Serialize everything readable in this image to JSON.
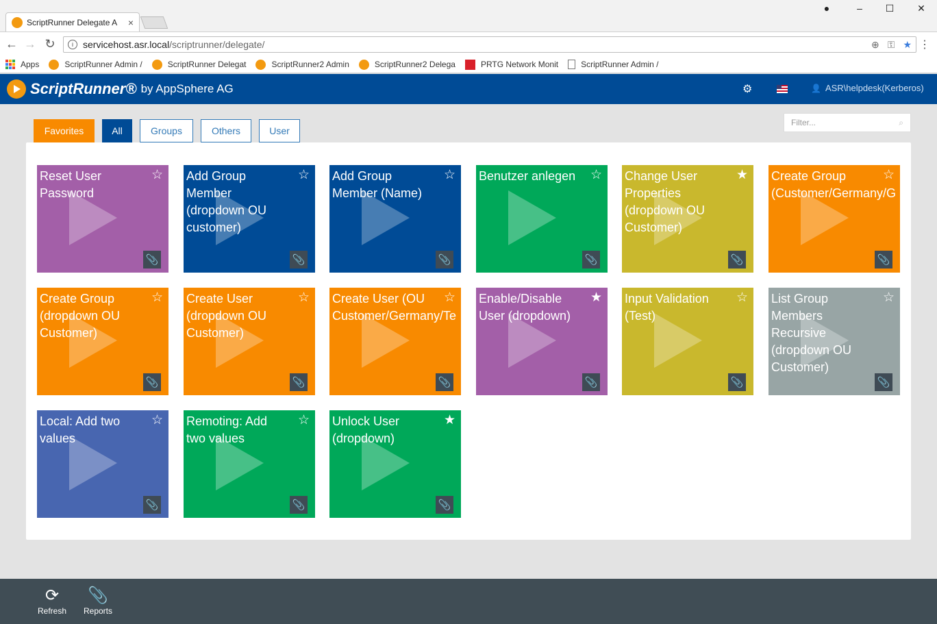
{
  "browser": {
    "tab_title": "ScriptRunner Delegate A",
    "tab_close": "×",
    "url_host": "servicehost.asr.local",
    "url_path": "/scriptrunner/delegate/",
    "controls": {
      "back": "←",
      "forward": "→",
      "reload": "↻",
      "minimize": "–",
      "maximize": "☐",
      "close": "✕",
      "account": "●",
      "menu": "⋮"
    },
    "omni_icons": {
      "zoom": "⊕",
      "key": "⚿",
      "star": "★"
    },
    "bookmarks": [
      {
        "label": "Apps",
        "icon": "apps-grid-icon"
      },
      {
        "label": "ScriptRunner Admin /",
        "icon": "scriptrunner-icon"
      },
      {
        "label": "ScriptRunner Delegat",
        "icon": "scriptrunner-icon"
      },
      {
        "label": "ScriptRunner2 Admin",
        "icon": "scriptrunner-icon"
      },
      {
        "label": "ScriptRunner2 Delega",
        "icon": "scriptrunner-icon"
      },
      {
        "label": "PRTG Network Monit",
        "icon": "prtg-icon"
      },
      {
        "label": "ScriptRunner Admin /",
        "icon": "page-icon"
      }
    ]
  },
  "app": {
    "logo_main": "ScriptRunner®",
    "logo_sub": "by AppSphere AG",
    "settings_icon": "⚙",
    "user_icon": "👤",
    "user_name": "ASR\\helpdesk(Kerberos)"
  },
  "filter_tabs": [
    "Favorites",
    "All",
    "Groups",
    "Others",
    "User"
  ],
  "filter": {
    "placeholder": "Filter...",
    "icon": "⌕"
  },
  "tiles": [
    {
      "name": "Reset User\nPassword",
      "color": "#a35fa8",
      "favorite": false
    },
    {
      "name": "Add Group\nMember\n(dropdown OU\ncustomer)",
      "color": "#004b96",
      "favorite": false
    },
    {
      "name": "Add Group\nMember (Name)",
      "color": "#004b96",
      "favorite": false
    },
    {
      "name": "Benutzer anlegen",
      "color": "#00a859",
      "favorite": false
    },
    {
      "name": "Change User\nProperties\n(dropdown OU\nCustomer)",
      "color": "#c9b82d",
      "favorite": true
    },
    {
      "name": "Create Group\n(Customer/Germany/G",
      "color": "#f88a00",
      "favorite": false
    },
    {
      "name": "Create Group\n(dropdown OU\nCustomer)",
      "color": "#f88a00",
      "favorite": false
    },
    {
      "name": "Create User\n(dropdown OU\nCustomer)",
      "color": "#f88a00",
      "favorite": false
    },
    {
      "name": "Create User (OU\nCustomer/Germany/Te",
      "color": "#f88a00",
      "favorite": false
    },
    {
      "name": "Enable/Disable\nUser (dropdown)",
      "color": "#a35fa8",
      "favorite": true
    },
    {
      "name": "Input Validation\n(Test)",
      "color": "#c9b82d",
      "favorite": false
    },
    {
      "name": "List Group\nMembers\nRecursive\n(dropdown OU\nCustomer)",
      "color": "#98a5a5",
      "favorite": false
    },
    {
      "name": "Local: Add two\nvalues",
      "color": "#4866b0",
      "favorite": false
    },
    {
      "name": "Remoting: Add\ntwo values",
      "color": "#00a859",
      "favorite": false
    },
    {
      "name": "Unlock User\n(dropdown)",
      "color": "#00a859",
      "favorite": true
    }
  ],
  "tile_icons": {
    "star_empty": "☆",
    "star_filled": "★",
    "clip": "📎"
  },
  "footer": {
    "refresh_label": "Refresh",
    "refresh_icon": "⟳",
    "reports_label": "Reports",
    "reports_icon": "📎"
  }
}
